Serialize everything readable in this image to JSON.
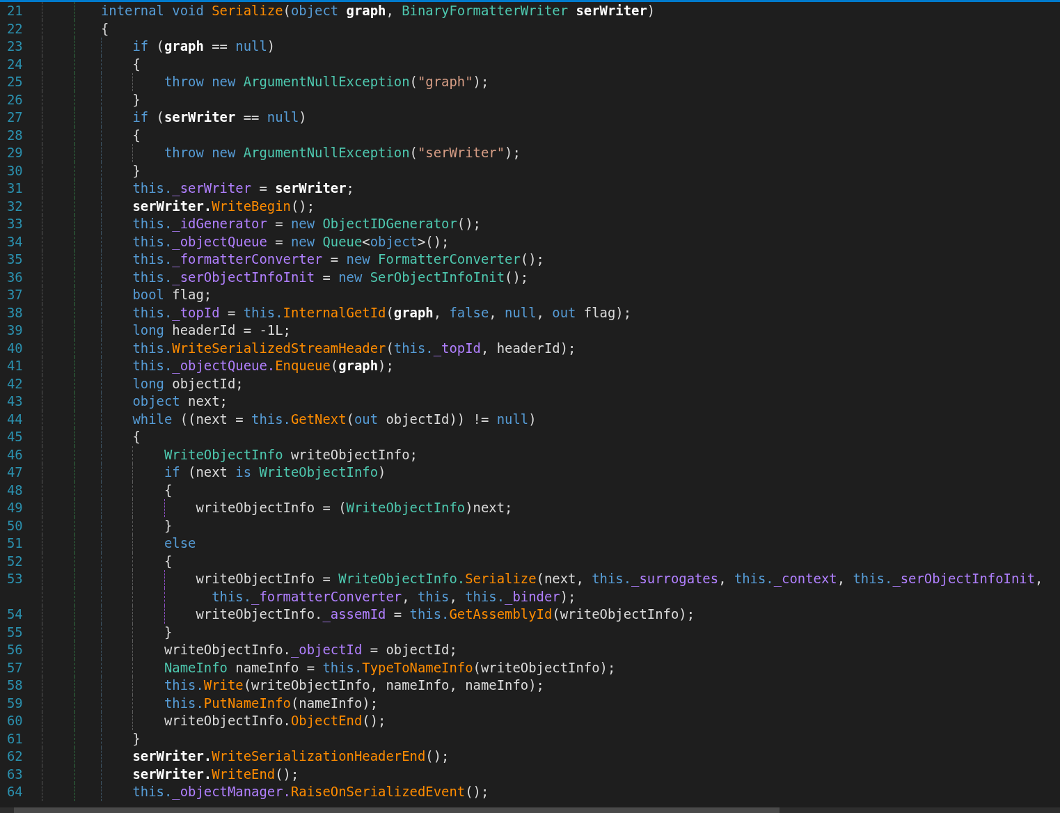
{
  "editor": {
    "lines": [
      {
        "number": "21",
        "tokens": [
          {
            "kind": "kw",
            "text": "internal void "
          },
          {
            "kind": "method",
            "text": "Serialize"
          },
          {
            "kind": "plain",
            "text": "("
          },
          {
            "kind": "kw",
            "text": "object "
          },
          {
            "kind": "param",
            "text": "graph"
          },
          {
            "kind": "plain",
            "text": ", "
          },
          {
            "kind": "type",
            "text": "BinaryFormatterWriter "
          },
          {
            "kind": "param",
            "text": "serWriter"
          },
          {
            "kind": "plain",
            "text": ")"
          }
        ]
      },
      {
        "number": "22",
        "tokens": [
          {
            "kind": "plain",
            "text": "{"
          }
        ],
        "children": [
          {
            "number": "23",
            "tokens": [
              {
                "kind": "kw",
                "text": "if"
              },
              {
                "kind": "plain",
                "text": " ("
              },
              {
                "kind": "param",
                "text": "graph"
              },
              {
                "kind": "plain",
                "text": " == "
              },
              {
                "kind": "kw",
                "text": "null"
              },
              {
                "kind": "plain",
                "text": ")"
              }
            ]
          },
          {
            "number": "24",
            "tokens": [
              {
                "kind": "plain",
                "text": "{"
              }
            ],
            "children": [
              {
                "number": "25",
                "tokens": [
                  {
                    "kind": "kw",
                    "text": "throw new "
                  },
                  {
                    "kind": "type",
                    "text": "ArgumentNullException"
                  },
                  {
                    "kind": "plain",
                    "text": "("
                  },
                  {
                    "kind": "str",
                    "text": "\"graph\""
                  },
                  {
                    "kind": "plain",
                    "text": ");"
                  }
                ]
              }
            ]
          },
          {
            "number": "26",
            "tokens": [
              {
                "kind": "plain",
                "text": "}"
              }
            ]
          },
          {
            "number": "27",
            "tokens": [
              {
                "kind": "kw",
                "text": "if"
              },
              {
                "kind": "plain",
                "text": " ("
              },
              {
                "kind": "param",
                "text": "serWriter"
              },
              {
                "kind": "plain",
                "text": " == "
              },
              {
                "kind": "kw",
                "text": "null"
              },
              {
                "kind": "plain",
                "text": ")"
              }
            ]
          },
          {
            "number": "28",
            "tokens": [
              {
                "kind": "plain",
                "text": "{"
              }
            ],
            "children": [
              {
                "number": "29",
                "tokens": [
                  {
                    "kind": "kw",
                    "text": "throw new "
                  },
                  {
                    "kind": "type",
                    "text": "ArgumentNullException"
                  },
                  {
                    "kind": "plain",
                    "text": "("
                  },
                  {
                    "kind": "str",
                    "text": "\"serWriter\""
                  },
                  {
                    "kind": "plain",
                    "text": ");"
                  }
                ]
              }
            ]
          },
          {
            "number": "30",
            "tokens": [
              {
                "kind": "plain",
                "text": "}"
              }
            ]
          },
          {
            "number": "31",
            "tokens": [
              {
                "kind": "kw",
                "text": "this."
              },
              {
                "kind": "field",
                "text": "_serWriter"
              },
              {
                "kind": "plain",
                "text": " = "
              },
              {
                "kind": "param",
                "text": "serWriter"
              },
              {
                "kind": "plain",
                "text": ";"
              }
            ]
          },
          {
            "number": "32",
            "tokens": [
              {
                "kind": "param",
                "text": "serWriter."
              },
              {
                "kind": "method",
                "text": "WriteBegin"
              },
              {
                "kind": "plain",
                "text": "();"
              }
            ]
          },
          {
            "number": "33",
            "tokens": [
              {
                "kind": "kw",
                "text": "this."
              },
              {
                "kind": "field",
                "text": "_idGenerator"
              },
              {
                "kind": "plain",
                "text": " = "
              },
              {
                "kind": "kw",
                "text": "new "
              },
              {
                "kind": "type",
                "text": "ObjectIDGenerator"
              },
              {
                "kind": "plain",
                "text": "();"
              }
            ]
          },
          {
            "number": "34",
            "tokens": [
              {
                "kind": "kw",
                "text": "this."
              },
              {
                "kind": "field",
                "text": "_objectQueue"
              },
              {
                "kind": "plain",
                "text": " = "
              },
              {
                "kind": "kw",
                "text": "new "
              },
              {
                "kind": "type",
                "text": "Queue"
              },
              {
                "kind": "plain",
                "text": "<"
              },
              {
                "kind": "kw",
                "text": "object"
              },
              {
                "kind": "plain",
                "text": ">();"
              }
            ]
          },
          {
            "number": "35",
            "tokens": [
              {
                "kind": "kw",
                "text": "this."
              },
              {
                "kind": "field",
                "text": "_formatterConverter"
              },
              {
                "kind": "plain",
                "text": " = "
              },
              {
                "kind": "kw",
                "text": "new "
              },
              {
                "kind": "type",
                "text": "FormatterConverter"
              },
              {
                "kind": "plain",
                "text": "();"
              }
            ]
          },
          {
            "number": "36",
            "tokens": [
              {
                "kind": "kw",
                "text": "this."
              },
              {
                "kind": "field",
                "text": "_serObjectInfoInit"
              },
              {
                "kind": "plain",
                "text": " = "
              },
              {
                "kind": "kw",
                "text": "new "
              },
              {
                "kind": "type",
                "text": "SerObjectInfoInit"
              },
              {
                "kind": "plain",
                "text": "();"
              }
            ]
          },
          {
            "number": "37",
            "tokens": [
              {
                "kind": "kw",
                "text": "bool"
              },
              {
                "kind": "plain",
                "text": " flag;"
              }
            ]
          },
          {
            "number": "38",
            "tokens": [
              {
                "kind": "kw",
                "text": "this."
              },
              {
                "kind": "field",
                "text": "_topId"
              },
              {
                "kind": "plain",
                "text": " = "
              },
              {
                "kind": "kw",
                "text": "this."
              },
              {
                "kind": "method",
                "text": "InternalGetId"
              },
              {
                "kind": "plain",
                "text": "("
              },
              {
                "kind": "param",
                "text": "graph"
              },
              {
                "kind": "plain",
                "text": ", "
              },
              {
                "kind": "kw",
                "text": "false"
              },
              {
                "kind": "plain",
                "text": ", "
              },
              {
                "kind": "kw",
                "text": "null"
              },
              {
                "kind": "plain",
                "text": ", "
              },
              {
                "kind": "kw",
                "text": "out"
              },
              {
                "kind": "plain",
                "text": " flag);"
              }
            ]
          },
          {
            "number": "39",
            "tokens": [
              {
                "kind": "kw",
                "text": "long"
              },
              {
                "kind": "plain",
                "text": " headerId = -1L;"
              }
            ]
          },
          {
            "number": "40",
            "tokens": [
              {
                "kind": "kw",
                "text": "this."
              },
              {
                "kind": "method",
                "text": "WriteSerializedStreamHeader"
              },
              {
                "kind": "plain",
                "text": "("
              },
              {
                "kind": "kw",
                "text": "this."
              },
              {
                "kind": "field",
                "text": "_topId"
              },
              {
                "kind": "plain",
                "text": ", headerId);"
              }
            ]
          },
          {
            "number": "41",
            "tokens": [
              {
                "kind": "kw",
                "text": "this."
              },
              {
                "kind": "field",
                "text": "_objectQueue."
              },
              {
                "kind": "method",
                "text": "Enqueue"
              },
              {
                "kind": "plain",
                "text": "("
              },
              {
                "kind": "param",
                "text": "graph"
              },
              {
                "kind": "plain",
                "text": ");"
              }
            ]
          },
          {
            "number": "42",
            "tokens": [
              {
                "kind": "kw",
                "text": "long"
              },
              {
                "kind": "plain",
                "text": " objectId;"
              }
            ]
          },
          {
            "number": "43",
            "tokens": [
              {
                "kind": "kw",
                "text": "object"
              },
              {
                "kind": "plain",
                "text": " next;"
              }
            ]
          },
          {
            "number": "44",
            "tokens": [
              {
                "kind": "kw",
                "text": "while"
              },
              {
                "kind": "plain",
                "text": " ((next = "
              },
              {
                "kind": "kw",
                "text": "this."
              },
              {
                "kind": "method",
                "text": "GetNext"
              },
              {
                "kind": "plain",
                "text": "("
              },
              {
                "kind": "kw",
                "text": "out"
              },
              {
                "kind": "plain",
                "text": " objectId)) != "
              },
              {
                "kind": "kw",
                "text": "null"
              },
              {
                "kind": "plain",
                "text": ")"
              }
            ]
          },
          {
            "number": "45",
            "tokens": [
              {
                "kind": "plain",
                "text": "{"
              }
            ],
            "children": [
              {
                "number": "46",
                "tokens": [
                  {
                    "kind": "type",
                    "text": "WriteObjectInfo"
                  },
                  {
                    "kind": "plain",
                    "text": " writeObjectInfo;"
                  }
                ]
              },
              {
                "number": "47",
                "tokens": [
                  {
                    "kind": "kw",
                    "text": "if"
                  },
                  {
                    "kind": "plain",
                    "text": " (next "
                  },
                  {
                    "kind": "kw",
                    "text": "is "
                  },
                  {
                    "kind": "type",
                    "text": "WriteObjectInfo"
                  },
                  {
                    "kind": "plain",
                    "text": ")"
                  }
                ]
              },
              {
                "number": "48",
                "tokens": [
                  {
                    "kind": "plain",
                    "text": "{"
                  }
                ],
                "children": [
                  {
                    "number": "49",
                    "tokens": [
                      {
                        "kind": "plain",
                        "text": "writeObjectInfo = ("
                      },
                      {
                        "kind": "type",
                        "text": "WriteObjectInfo"
                      },
                      {
                        "kind": "plain",
                        "text": ")next;"
                      }
                    ]
                  }
                ]
              },
              {
                "number": "50",
                "tokens": [
                  {
                    "kind": "plain",
                    "text": "}"
                  }
                ]
              },
              {
                "number": "51",
                "tokens": [
                  {
                    "kind": "kw",
                    "text": "else"
                  }
                ]
              },
              {
                "number": "52",
                "tokens": [
                  {
                    "kind": "plain",
                    "text": "{"
                  }
                ],
                "children": [
                  {
                    "number": "53",
                    "tokens": [
                      {
                        "kind": "plain",
                        "text": "writeObjectInfo = "
                      },
                      {
                        "kind": "type",
                        "text": "WriteObjectInfo."
                      },
                      {
                        "kind": "method",
                        "text": "Serialize"
                      },
                      {
                        "kind": "plain",
                        "text": "(next, "
                      },
                      {
                        "kind": "kw",
                        "text": "this."
                      },
                      {
                        "kind": "field",
                        "text": "_surrogates"
                      },
                      {
                        "kind": "plain",
                        "text": ", "
                      },
                      {
                        "kind": "kw",
                        "text": "this."
                      },
                      {
                        "kind": "field",
                        "text": "_context"
                      },
                      {
                        "kind": "plain",
                        "text": ", "
                      },
                      {
                        "kind": "kw",
                        "text": "this."
                      },
                      {
                        "kind": "field",
                        "text": "_serObjectInfoInit"
                      },
                      {
                        "kind": "plain",
                        "text": ","
                      }
                    ],
                    "wrap": [
                      {
                        "kind": "kw",
                        "text": "this."
                      },
                      {
                        "kind": "field",
                        "text": "_formatterConverter"
                      },
                      {
                        "kind": "plain",
                        "text": ", "
                      },
                      {
                        "kind": "kw",
                        "text": "this"
                      },
                      {
                        "kind": "plain",
                        "text": ", "
                      },
                      {
                        "kind": "kw",
                        "text": "this."
                      },
                      {
                        "kind": "field",
                        "text": "_binder"
                      },
                      {
                        "kind": "plain",
                        "text": ");"
                      }
                    ]
                  },
                  {
                    "number": "54",
                    "tokens": [
                      {
                        "kind": "plain",
                        "text": "writeObjectInfo."
                      },
                      {
                        "kind": "field",
                        "text": "_assemId"
                      },
                      {
                        "kind": "plain",
                        "text": " = "
                      },
                      {
                        "kind": "kw",
                        "text": "this."
                      },
                      {
                        "kind": "method",
                        "text": "GetAssemblyId"
                      },
                      {
                        "kind": "plain",
                        "text": "(writeObjectInfo);"
                      }
                    ]
                  }
                ]
              },
              {
                "number": "55",
                "tokens": [
                  {
                    "kind": "plain",
                    "text": "}"
                  }
                ]
              },
              {
                "number": "56",
                "tokens": [
                  {
                    "kind": "plain",
                    "text": "writeObjectInfo."
                  },
                  {
                    "kind": "field",
                    "text": "_objectId"
                  },
                  {
                    "kind": "plain",
                    "text": " = objectId;"
                  }
                ]
              },
              {
                "number": "57",
                "tokens": [
                  {
                    "kind": "type",
                    "text": "NameInfo"
                  },
                  {
                    "kind": "plain",
                    "text": " nameInfo = "
                  },
                  {
                    "kind": "kw",
                    "text": "this."
                  },
                  {
                    "kind": "method",
                    "text": "TypeToNameInfo"
                  },
                  {
                    "kind": "plain",
                    "text": "(writeObjectInfo);"
                  }
                ]
              },
              {
                "number": "58",
                "tokens": [
                  {
                    "kind": "kw",
                    "text": "this."
                  },
                  {
                    "kind": "method",
                    "text": "Write"
                  },
                  {
                    "kind": "plain",
                    "text": "(writeObjectInfo, nameInfo, nameInfo);"
                  }
                ]
              },
              {
                "number": "59",
                "tokens": [
                  {
                    "kind": "kw",
                    "text": "this."
                  },
                  {
                    "kind": "method",
                    "text": "PutNameInfo"
                  },
                  {
                    "kind": "plain",
                    "text": "(nameInfo);"
                  }
                ]
              },
              {
                "number": "60",
                "tokens": [
                  {
                    "kind": "plain",
                    "text": "writeObjectInfo."
                  },
                  {
                    "kind": "method",
                    "text": "ObjectEnd"
                  },
                  {
                    "kind": "plain",
                    "text": "();"
                  }
                ]
              }
            ]
          },
          {
            "number": "61",
            "tokens": [
              {
                "kind": "plain",
                "text": "}"
              }
            ]
          },
          {
            "number": "62",
            "tokens": [
              {
                "kind": "param",
                "text": "serWriter."
              },
              {
                "kind": "method",
                "text": "WriteSerializationHeaderEnd"
              },
              {
                "kind": "plain",
                "text": "();"
              }
            ]
          },
          {
            "number": "63",
            "tokens": [
              {
                "kind": "param",
                "text": "serWriter."
              },
              {
                "kind": "method",
                "text": "WriteEnd"
              },
              {
                "kind": "plain",
                "text": "();"
              }
            ]
          },
          {
            "number": "64",
            "tokens": [
              {
                "kind": "kw",
                "text": "this."
              },
              {
                "kind": "field",
                "text": "_objectManager."
              },
              {
                "kind": "method",
                "text": "RaiseOnSerializedEvent"
              },
              {
                "kind": "plain",
                "text": "();"
              }
            ]
          }
        ]
      }
    ]
  }
}
